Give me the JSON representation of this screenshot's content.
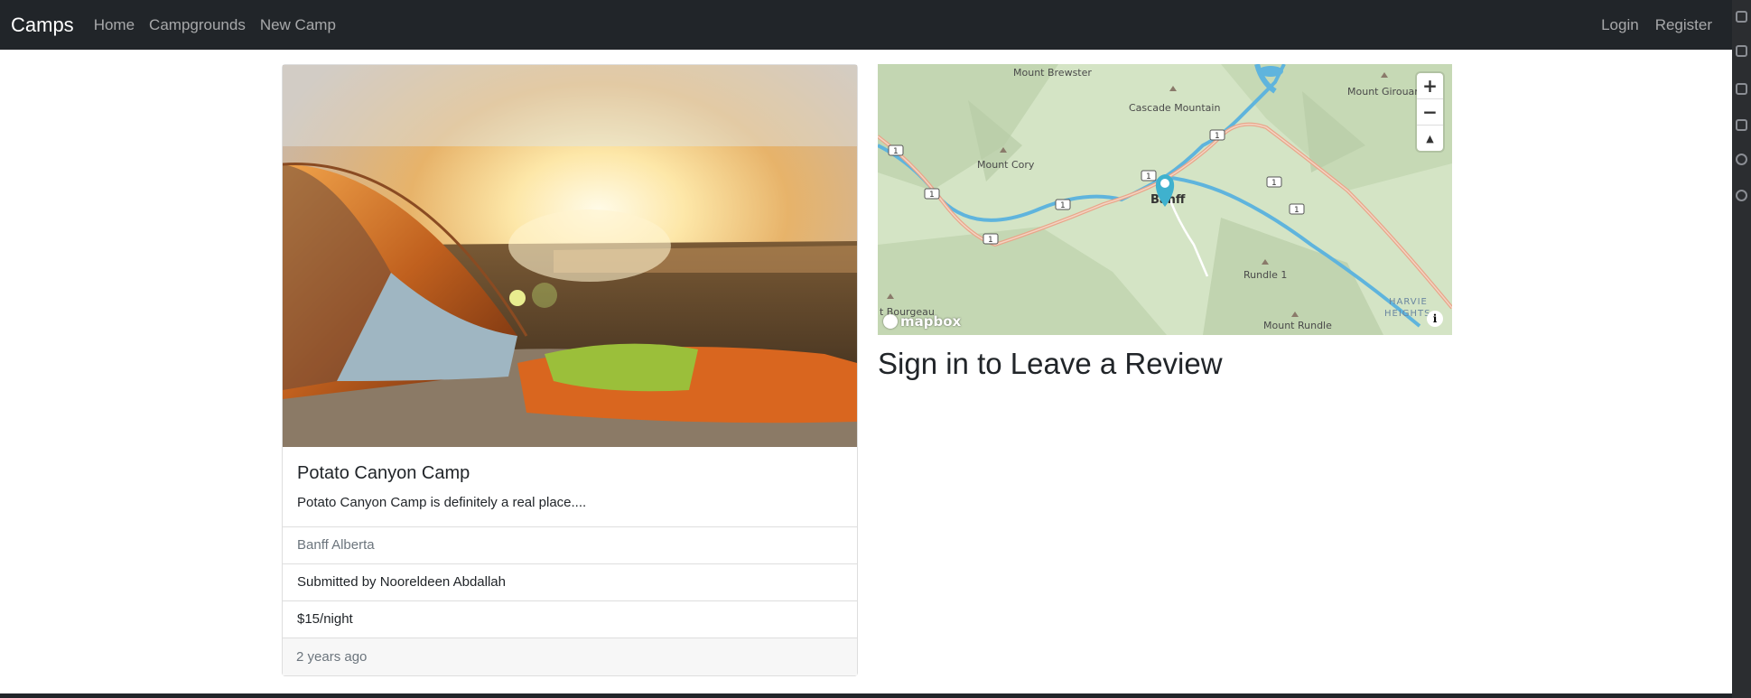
{
  "navbar": {
    "brand": "Camps",
    "links": [
      "Home",
      "Campgrounds",
      "New Camp"
    ],
    "right_links": [
      "Login",
      "Register"
    ]
  },
  "campground": {
    "title": "Potato Canyon Camp",
    "description": "Potato Canyon Camp is definitely a real place....",
    "location": "Banff Alberta",
    "submitted_by": "Submitted by Nooreldeen Abdallah",
    "price": "$15/night",
    "posted": "2 years ago"
  },
  "map": {
    "labels": {
      "mount_brewster": "Mount Brewster",
      "cascade_mountain": "Cascade Mountain",
      "mount_girouard": "Mount Girouard",
      "mount_cory": "Mount Cory",
      "banff": "Banff",
      "rundle": "Rundle 1",
      "mount_bourgeau": "t Bourgeau",
      "mount_rundle": "Mount Rundle",
      "harvie": "HARVIE",
      "heights": "HEIGHTS"
    },
    "highway_shield": "1",
    "zoom_in": "+",
    "zoom_out": "−",
    "compass": "▲",
    "attribution_logo": "mapbox",
    "info": "i",
    "marker_color": "#3fb1ce"
  },
  "review": {
    "heading": "Sign in to Leave a Review"
  },
  "colors": {
    "navbar_bg": "#212529",
    "map_land": "#d4e4c5",
    "map_water": "#5fb4dd",
    "map_road": "#e8a68a"
  }
}
